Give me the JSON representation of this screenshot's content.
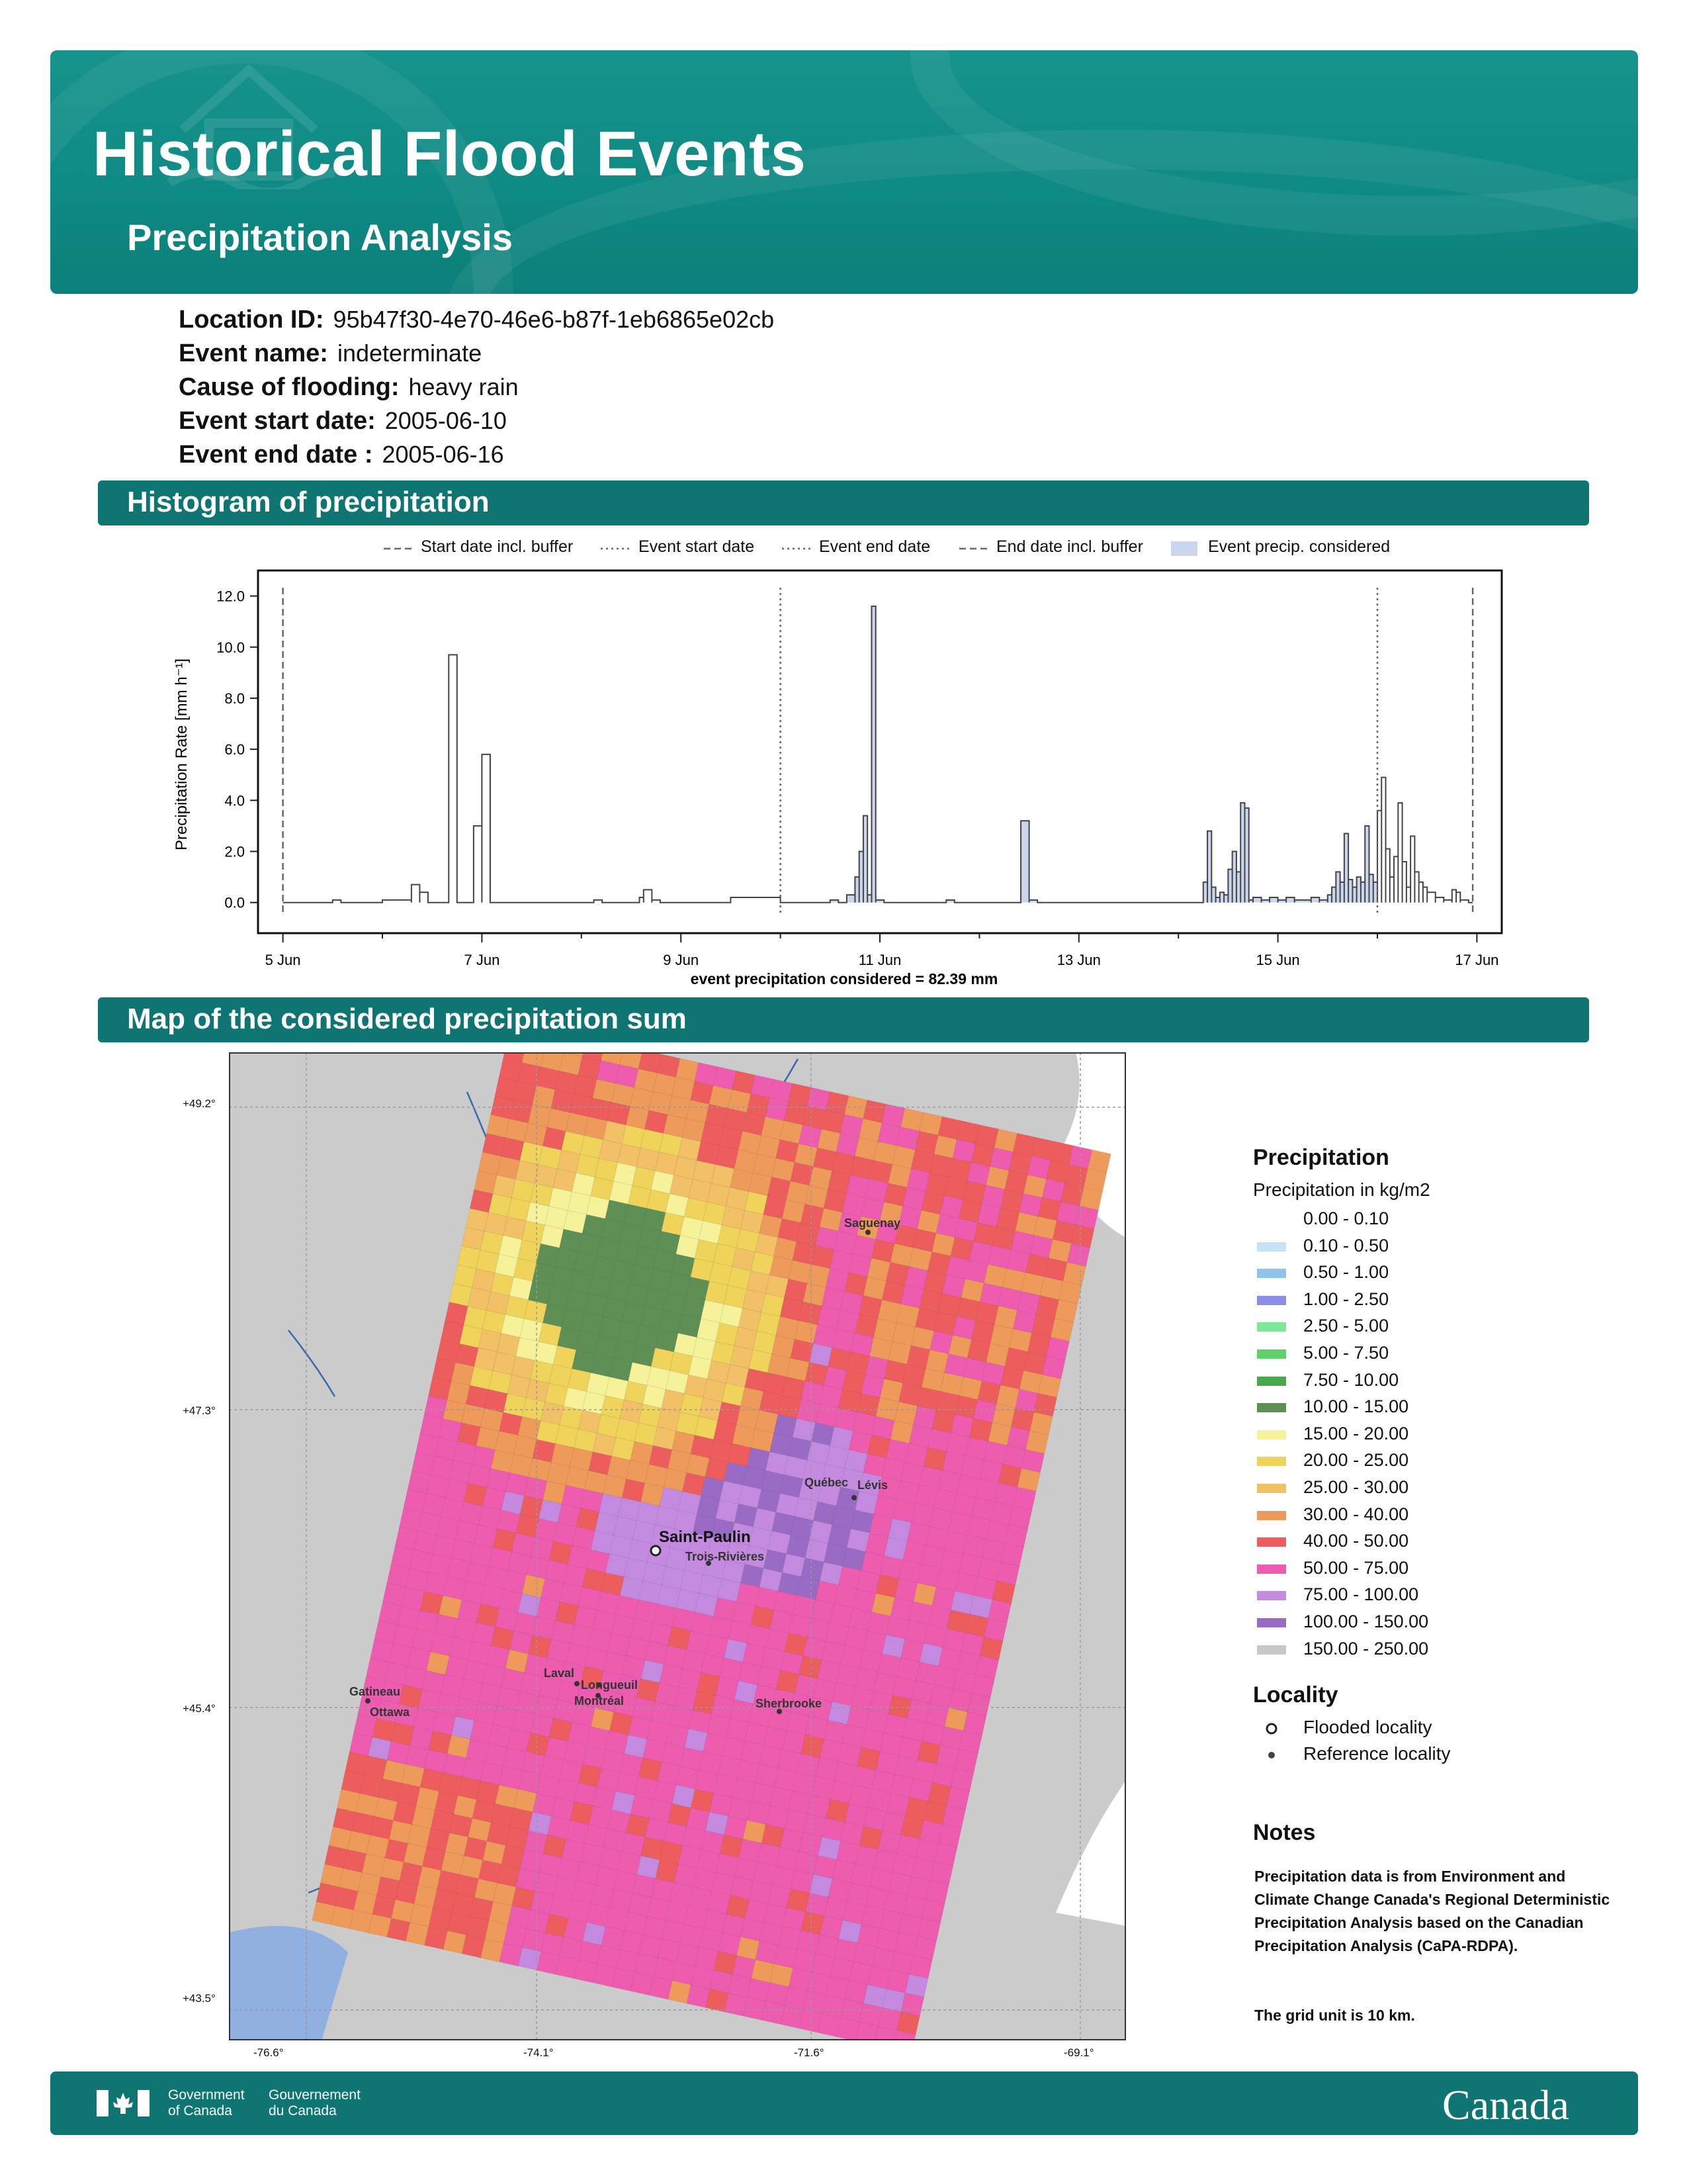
{
  "header": {
    "title": "Historical Flood Events",
    "subtitle": "Precipitation Analysis"
  },
  "info": {
    "location_label": "Location ID:",
    "location_value": "95b47f30-4e70-46e6-b87f-1eb6865e02cb",
    "event_name_label": "Event name:",
    "event_name_value": "indeterminate",
    "cause_label": "Cause of flooding:",
    "cause_value": "heavy rain",
    "start_label": "Event start date:",
    "start_value": "2005-06-10",
    "end_label": "Event end date :",
    "end_value": "2005-06-16"
  },
  "sections": {
    "histogram": "Histogram of precipitation",
    "map": "Map of the considered precipitation sum"
  },
  "chart_data": {
    "type": "bar",
    "ylabel": "Precipitation Rate [mm h⁻¹]",
    "xlabel": "event precipitation considered = 82.39 mm",
    "ylim": [
      -1.2,
      13.0
    ],
    "yticks": [
      "0.0",
      "2.0",
      "4.0",
      "6.0",
      "8.0",
      "10.0",
      "12.0"
    ],
    "xlim": [
      "2005-06-04T18:00",
      "2005-06-17T06:00"
    ],
    "xticks": [
      {
        "date": "2005-06-05",
        "label": "5 Jun"
      },
      {
        "date": "2005-06-07",
        "label": "7 Jun"
      },
      {
        "date": "2005-06-09",
        "label": "9 Jun"
      },
      {
        "date": "2005-06-11",
        "label": "11 Jun"
      },
      {
        "date": "2005-06-13",
        "label": "13 Jun"
      },
      {
        "date": "2005-06-15",
        "label": "15 Jun"
      },
      {
        "date": "2005-06-17",
        "label": "17 Jun"
      }
    ],
    "legend": {
      "placement": "top",
      "entries": [
        {
          "label": "Start date incl. buffer",
          "style": "dashed"
        },
        {
          "label": "Event start date",
          "style": "dotted"
        },
        {
          "label": "Event end date",
          "style": "dotted"
        },
        {
          "label": "End date incl. buffer",
          "style": "dashed"
        },
        {
          "label": "Event precip. considered",
          "style": "fill"
        }
      ]
    },
    "markers": [
      {
        "name": "Start date incl. buffer",
        "date": "2005-06-05T00:00",
        "style": "dashed"
      },
      {
        "name": "Event start date",
        "date": "2005-06-10T00:00",
        "style": "dotted"
      },
      {
        "name": "Event end date",
        "date": "2005-06-16T00:00",
        "style": "dotted"
      },
      {
        "name": "End date incl. buffer",
        "date": "2005-06-16T23:00",
        "style": "dashed"
      }
    ],
    "colors": {
      "line": "#444444",
      "event_fill": "#c9d6ee"
    },
    "series": [
      {
        "values": [
          {
            "date": "2005-06-05T12:00",
            "end": "2005-06-05T14:00",
            "v": 0.1
          },
          {
            "date": "2005-06-06T00:00",
            "end": "2005-06-06T07:00",
            "v": 0.1
          },
          {
            "date": "2005-06-06T07:00",
            "end": "2005-06-06T09:00",
            "v": 0.7
          },
          {
            "date": "2005-06-06T09:00",
            "end": "2005-06-06T11:00",
            "v": 0.4
          },
          {
            "date": "2005-06-06T16:00",
            "end": "2005-06-06T18:00",
            "v": 9.7
          },
          {
            "date": "2005-06-06T22:00",
            "end": "2005-06-07T00:00",
            "v": 3.0
          },
          {
            "date": "2005-06-07T00:00",
            "end": "2005-06-07T02:00",
            "v": 5.8
          },
          {
            "date": "2005-06-08T03:00",
            "end": "2005-06-08T05:00",
            "v": 0.1
          },
          {
            "date": "2005-06-08T14:00",
            "end": "2005-06-08T15:00",
            "v": 0.2
          },
          {
            "date": "2005-06-08T15:00",
            "end": "2005-06-08T17:00",
            "v": 0.5
          },
          {
            "date": "2005-06-08T17:00",
            "end": "2005-06-08T19:00",
            "v": 0.1
          },
          {
            "date": "2005-06-09T12:00",
            "end": "2005-06-10T00:00",
            "v": 0.2
          },
          {
            "date": "2005-06-10T12:00",
            "end": "2005-06-10T14:00",
            "v": 0.1
          },
          {
            "date": "2005-06-10T16:00",
            "end": "2005-06-10T18:00",
            "v": 0.3
          },
          {
            "date": "2005-06-10T18:00",
            "end": "2005-06-10T19:00",
            "v": 1.0
          },
          {
            "date": "2005-06-10T19:00",
            "end": "2005-06-10T20:00",
            "v": 2.0
          },
          {
            "date": "2005-06-10T20:00",
            "end": "2005-06-10T21:00",
            "v": 3.4
          },
          {
            "date": "2005-06-10T21:00",
            "end": "2005-06-10T22:00",
            "v": 0.3
          },
          {
            "date": "2005-06-10T22:00",
            "end": "2005-06-10T23:00",
            "v": 11.6
          },
          {
            "date": "2005-06-10T23:00",
            "end": "2005-06-11T01:00",
            "v": 0.1
          },
          {
            "date": "2005-06-11T16:00",
            "end": "2005-06-11T18:00",
            "v": 0.1
          },
          {
            "date": "2005-06-12T10:00",
            "end": "2005-06-12T12:00",
            "v": 3.2
          },
          {
            "date": "2005-06-12T12:00",
            "end": "2005-06-12T14:00",
            "v": 0.1
          },
          {
            "date": "2005-06-14T06:00",
            "end": "2005-06-14T07:00",
            "v": 0.8
          },
          {
            "date": "2005-06-14T07:00",
            "end": "2005-06-14T08:00",
            "v": 2.8
          },
          {
            "date": "2005-06-14T08:00",
            "end": "2005-06-14T09:00",
            "v": 0.6
          },
          {
            "date": "2005-06-14T09:00",
            "end": "2005-06-14T10:00",
            "v": 0.2
          },
          {
            "date": "2005-06-14T10:00",
            "end": "2005-06-14T11:00",
            "v": 0.4
          },
          {
            "date": "2005-06-14T11:00",
            "end": "2005-06-14T12:00",
            "v": 0.3
          },
          {
            "date": "2005-06-14T12:00",
            "end": "2005-06-14T13:00",
            "v": 1.3
          },
          {
            "date": "2005-06-14T13:00",
            "end": "2005-06-14T14:00",
            "v": 2.0
          },
          {
            "date": "2005-06-14T14:00",
            "end": "2005-06-14T15:00",
            "v": 1.2
          },
          {
            "date": "2005-06-14T15:00",
            "end": "2005-06-14T16:00",
            "v": 3.9
          },
          {
            "date": "2005-06-14T16:00",
            "end": "2005-06-14T17:00",
            "v": 3.7
          },
          {
            "date": "2005-06-14T17:00",
            "end": "2005-06-14T18:00",
            "v": 0.1
          },
          {
            "date": "2005-06-14T18:00",
            "end": "2005-06-14T20:00",
            "v": 0.2
          },
          {
            "date": "2005-06-14T20:00",
            "end": "2005-06-14T22:00",
            "v": 0.1
          },
          {
            "date": "2005-06-14T22:00",
            "end": "2005-06-15T00:00",
            "v": 0.2
          },
          {
            "date": "2005-06-15T00:00",
            "end": "2005-06-15T02:00",
            "v": 0.1
          },
          {
            "date": "2005-06-15T02:00",
            "end": "2005-06-15T04:00",
            "v": 0.2
          },
          {
            "date": "2005-06-15T04:00",
            "end": "2005-06-15T08:00",
            "v": 0.1
          },
          {
            "date": "2005-06-15T08:00",
            "end": "2005-06-15T10:00",
            "v": 0.2
          },
          {
            "date": "2005-06-15T10:00",
            "end": "2005-06-15T12:00",
            "v": 0.1
          },
          {
            "date": "2005-06-15T12:00",
            "end": "2005-06-15T13:00",
            "v": 0.3
          },
          {
            "date": "2005-06-15T13:00",
            "end": "2005-06-15T14:00",
            "v": 0.6
          },
          {
            "date": "2005-06-15T14:00",
            "end": "2005-06-15T15:00",
            "v": 1.2
          },
          {
            "date": "2005-06-15T15:00",
            "end": "2005-06-15T16:00",
            "v": 0.8
          },
          {
            "date": "2005-06-15T16:00",
            "end": "2005-06-15T17:00",
            "v": 2.7
          },
          {
            "date": "2005-06-15T17:00",
            "end": "2005-06-15T18:00",
            "v": 0.9
          },
          {
            "date": "2005-06-15T18:00",
            "end": "2005-06-15T19:00",
            "v": 0.6
          },
          {
            "date": "2005-06-15T19:00",
            "end": "2005-06-15T20:00",
            "v": 1.0
          },
          {
            "date": "2005-06-15T20:00",
            "end": "2005-06-15T21:00",
            "v": 0.8
          },
          {
            "date": "2005-06-15T21:00",
            "end": "2005-06-15T22:00",
            "v": 3.0
          },
          {
            "date": "2005-06-15T22:00",
            "end": "2005-06-15T23:00",
            "v": 1.1
          },
          {
            "date": "2005-06-15T23:00",
            "end": "2005-06-16T00:00",
            "v": 0.8
          },
          {
            "date": "2005-06-16T00:00",
            "end": "2005-06-16T01:00",
            "v": 3.6
          },
          {
            "date": "2005-06-16T01:00",
            "end": "2005-06-16T02:00",
            "v": 4.9
          },
          {
            "date": "2005-06-16T02:00",
            "end": "2005-06-16T03:00",
            "v": 2.1
          },
          {
            "date": "2005-06-16T03:00",
            "end": "2005-06-16T04:00",
            "v": 1.0
          },
          {
            "date": "2005-06-16T04:00",
            "end": "2005-06-16T05:00",
            "v": 1.8
          },
          {
            "date": "2005-06-16T05:00",
            "end": "2005-06-16T06:00",
            "v": 3.9
          },
          {
            "date": "2005-06-16T06:00",
            "end": "2005-06-16T07:00",
            "v": 1.6
          },
          {
            "date": "2005-06-16T07:00",
            "end": "2005-06-16T08:00",
            "v": 0.6
          },
          {
            "date": "2005-06-16T08:00",
            "end": "2005-06-16T09:00",
            "v": 2.6
          },
          {
            "date": "2005-06-16T09:00",
            "end": "2005-06-16T10:00",
            "v": 1.2
          },
          {
            "date": "2005-06-16T10:00",
            "end": "2005-06-16T11:00",
            "v": 0.8
          },
          {
            "date": "2005-06-16T11:00",
            "end": "2005-06-16T12:00",
            "v": 0.6
          },
          {
            "date": "2005-06-16T12:00",
            "end": "2005-06-16T14:00",
            "v": 0.4
          },
          {
            "date": "2005-06-16T14:00",
            "end": "2005-06-16T16:00",
            "v": 0.2
          },
          {
            "date": "2005-06-16T16:00",
            "end": "2005-06-16T18:00",
            "v": 0.1
          },
          {
            "date": "2005-06-16T18:00",
            "end": "2005-06-16T19:00",
            "v": 0.5
          },
          {
            "date": "2005-06-16T19:00",
            "end": "2005-06-16T20:00",
            "v": 0.4
          },
          {
            "date": "2005-06-16T20:00",
            "end": "2005-06-16T22:00",
            "v": 0.1
          }
        ]
      }
    ]
  },
  "map": {
    "lat_ticks": [
      "+49.2°",
      "+47.3°",
      "+45.4°",
      "+43.5°"
    ],
    "lon_ticks": [
      "-76.6°",
      "-74.1°",
      "-71.6°",
      "-69.1°"
    ],
    "places": [
      {
        "name": "Saguenay",
        "kind": "reference"
      },
      {
        "name": "Québec",
        "kind": "reference"
      },
      {
        "name": "Lévis",
        "kind": "reference"
      },
      {
        "name": "Saint-Paulin",
        "kind": "flooded"
      },
      {
        "name": "Trois-Rivières",
        "kind": "reference"
      },
      {
        "name": "Laval",
        "kind": "reference"
      },
      {
        "name": "Longueuil",
        "kind": "reference"
      },
      {
        "name": "Montréal",
        "kind": "reference"
      },
      {
        "name": "Gatineau",
        "kind": "reference"
      },
      {
        "name": "Ottawa",
        "kind": "reference"
      },
      {
        "name": "Sherbrooke",
        "kind": "reference"
      }
    ]
  },
  "legend": {
    "title": "Precipitation",
    "subtitle": "Precipitation in kg/m2",
    "classes": [
      {
        "label": "0.00 - 0.10",
        "color": "#ffffff"
      },
      {
        "label": "0.10 - 0.50",
        "color": "#c6e2f7"
      },
      {
        "label": "0.50 - 1.00",
        "color": "#8ec3ee"
      },
      {
        "label": "1.00 - 2.50",
        "color": "#8a8ee8"
      },
      {
        "label": "2.50 - 5.00",
        "color": "#7ee89a"
      },
      {
        "label": "5.00 - 7.50",
        "color": "#62cf6a"
      },
      {
        "label": "7.50 - 10.00",
        "color": "#4aa84e"
      },
      {
        "label": "10.00 - 15.00",
        "color": "#5e8f54"
      },
      {
        "label": "15.00 - 20.00",
        "color": "#f5f29a"
      },
      {
        "label": "20.00 - 25.00",
        "color": "#f0d35a"
      },
      {
        "label": "25.00 - 30.00",
        "color": "#f2c067"
      },
      {
        "label": "30.00 - 40.00",
        "color": "#ee9a5a"
      },
      {
        "label": "40.00 - 50.00",
        "color": "#ee5d5d"
      },
      {
        "label": "50.00 - 75.00",
        "color": "#ee5cb0"
      },
      {
        "label": "75.00 - 100.00",
        "color": "#c48ae0"
      },
      {
        "label": "100.00 - 150.00",
        "color": "#9a6bc4"
      },
      {
        "label": "150.00 - 250.00",
        "color": "#c8c8c8"
      }
    ],
    "locality_title": "Locality",
    "flooded_label": "Flooded locality",
    "reference_label": "Reference locality"
  },
  "notes": {
    "title": "Notes",
    "text1": "Precipitation data is from Environment and Climate Change Canada's Regional Deterministic Precipitation Analysis based on the Canadian Precipitation Analysis (CaPA-RDPA).",
    "text2": "The grid unit is 10 km."
  },
  "footer": {
    "gov_en_1": "Government",
    "gov_en_2": "of Canada",
    "gov_fr_1": "Gouvernement",
    "gov_fr_2": "du Canada",
    "wordmark": "Canada"
  }
}
